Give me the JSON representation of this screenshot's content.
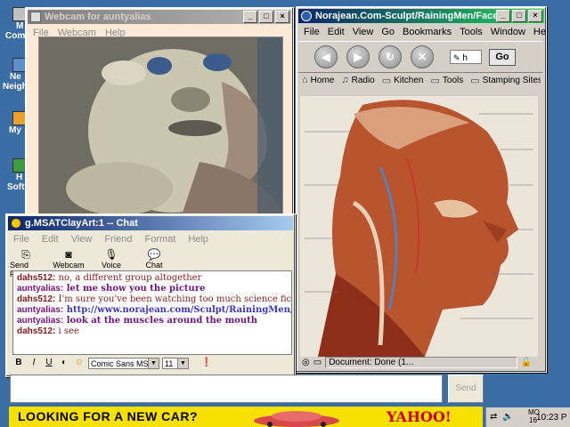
{
  "desktop": {
    "icons": [
      {
        "label": "M",
        "label2": "Com",
        "icon": "computer-icon"
      },
      {
        "label": "Ne",
        "label2": "Neigh",
        "icon": "network-icon"
      },
      {
        "label": "My",
        "label2": "",
        "icon": "documents-icon"
      },
      {
        "label": "H",
        "label2": "Soft",
        "icon": "software-icon"
      }
    ]
  },
  "webcam_window": {
    "title": "Webcam for auntyalias",
    "menu": [
      "File",
      "Webcam",
      "Help"
    ]
  },
  "browser_window": {
    "title": "Norajean.Com-Sculpt/RainingMen/Face",
    "menu": [
      "File",
      "Edit",
      "View",
      "Go",
      "Bookmarks",
      "Tools",
      "Window",
      "He"
    ],
    "address_value": "h",
    "go_label": "Go",
    "personal_toolbar": [
      "Home",
      "Radio",
      "Kitchen",
      "Tools",
      "Stamping Sites"
    ],
    "status_text": "Document: Done (1..."
  },
  "chat_window": {
    "title": "g.MSATClayArt:1 -- Chat",
    "menu": [
      "File",
      "Edit",
      "View",
      "Friend",
      "Format",
      "Help"
    ],
    "tools": [
      {
        "label": "Send File",
        "icon": "send-file-icon"
      },
      {
        "label": "Webcam",
        "icon": "webcam-icon"
      },
      {
        "label": "Voice",
        "icon": "microphone-icon"
      },
      {
        "label": "Chat",
        "icon": "chat-icon"
      }
    ],
    "messages": [
      {
        "nick": "dahs512:",
        "text": " no, a different group altogether",
        "who": "d"
      },
      {
        "nick": "auntyalias:",
        "text": " let me show you the picture",
        "who": "a"
      },
      {
        "nick": "dahs512:",
        "text": " I'm sure you've been watching too much science fiction",
        "who": "d"
      },
      {
        "nick": "auntyalias:",
        "text": " http://www.norajean.com/Sculpt/RainingMen/Face",
        "who": "link"
      },
      {
        "nick": "auntyalias:",
        "text": " look at the muscles around the mouth",
        "who": "a"
      },
      {
        "nick": "dahs512:",
        "text": " i see",
        "who": "d"
      }
    ],
    "format": {
      "bold": "B",
      "italic": "I",
      "underline": "U",
      "font": "Comic Sans MS",
      "size": "11"
    },
    "input_value": "",
    "send_label": "Send"
  },
  "ad": {
    "headline": "LOOKING FOR A NEW CAR?",
    "brand": "YAHOO! Auto"
  },
  "taskbar": {
    "day": "MO",
    "date": "16",
    "time": "10:23 P"
  }
}
